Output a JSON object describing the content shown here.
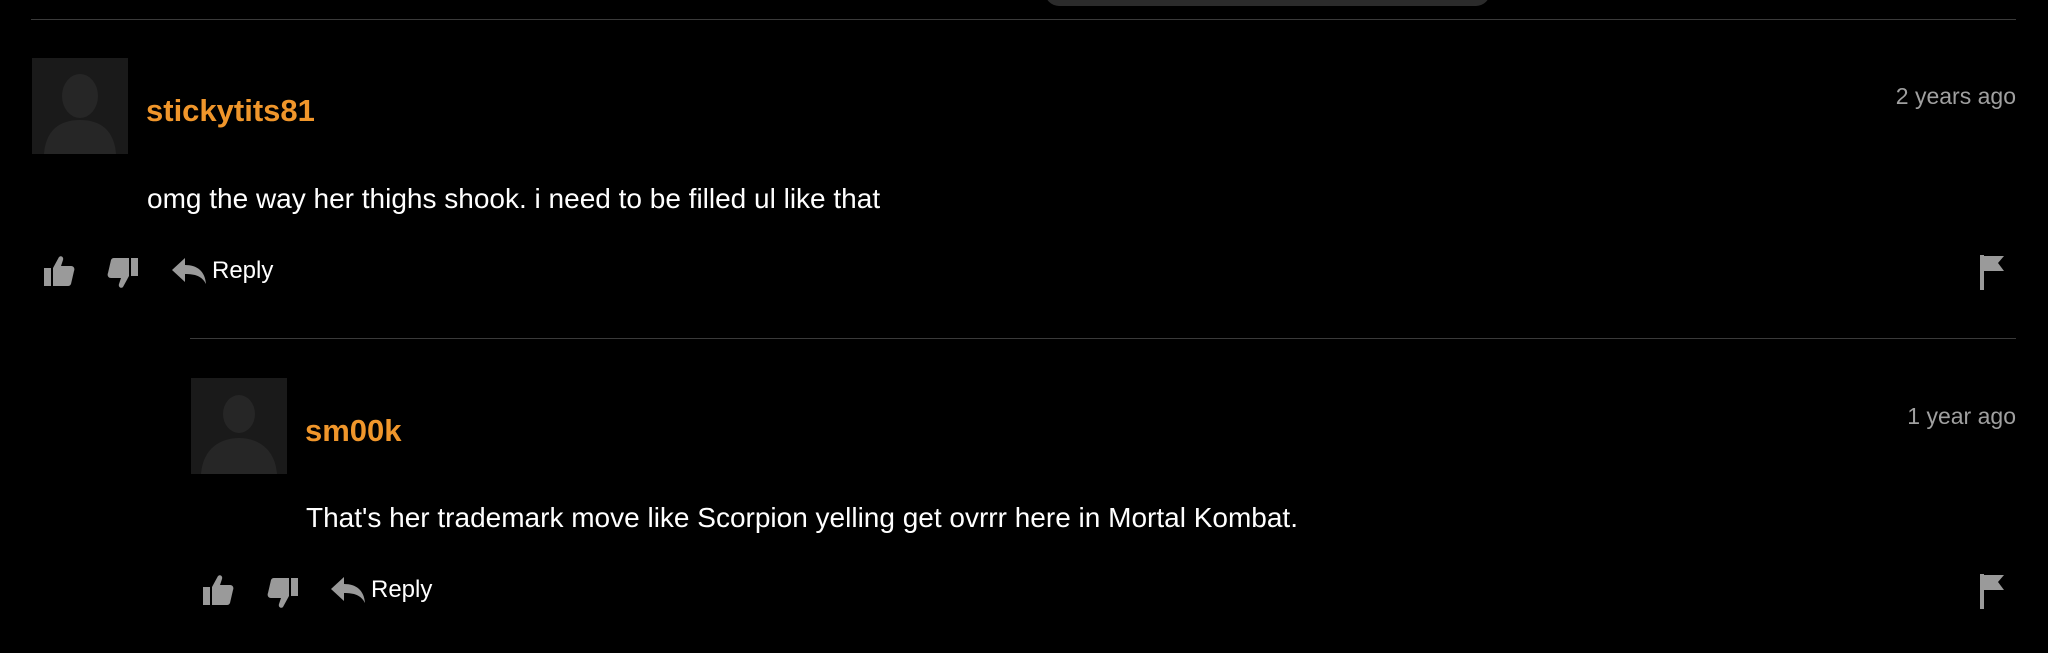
{
  "comments": [
    {
      "username": "stickytits81",
      "timestamp": "2 years ago",
      "text": "omg the way her thighs shook. i need to be filled ul like that",
      "reply_label": "Reply"
    },
    {
      "username": "sm00k",
      "timestamp": "1 year ago",
      "text": "That's her trademark move like Scorpion yelling get ovrrr here in Mortal Kombat.",
      "reply_label": "Reply"
    }
  ],
  "colors": {
    "background": "#000000",
    "username": "#f0962b",
    "text": "#ffffff",
    "muted": "#a0a0a0",
    "icon": "#9a9a9a",
    "divider": "#3a3a3a",
    "avatar_bg": "#1a1a1a"
  },
  "icons": [
    "thumbs-up-icon",
    "thumbs-down-icon",
    "reply-arrow-icon",
    "flag-icon"
  ]
}
